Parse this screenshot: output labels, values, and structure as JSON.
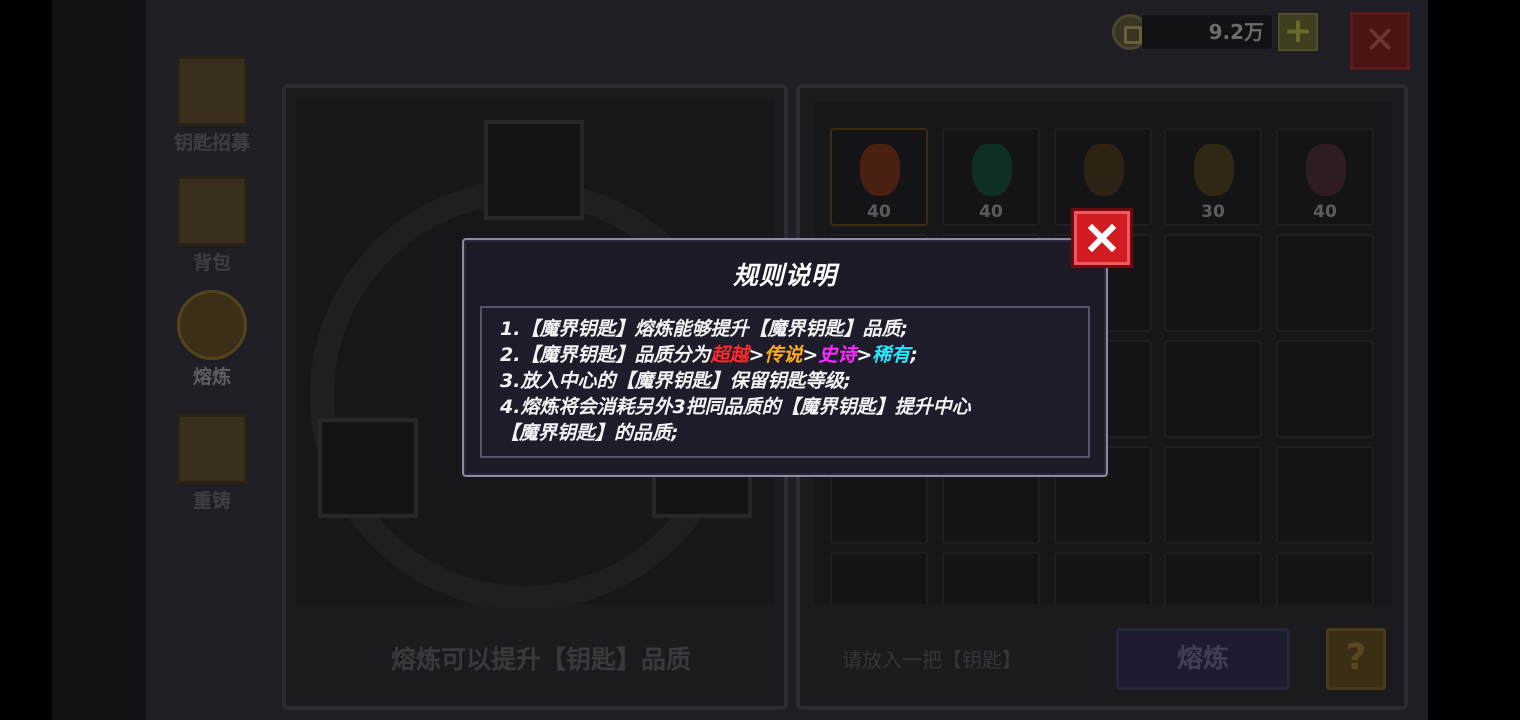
{
  "header": {
    "currency_amount": "9.2万",
    "add_label": "+",
    "close_label": "✕"
  },
  "sidebar": {
    "items": [
      {
        "label": "钥匙招募",
        "icon": "recruit-gate-icon"
      },
      {
        "label": "背包",
        "icon": "backpack-icon"
      },
      {
        "label": "熔炼",
        "icon": "smelt-icon",
        "active": true
      },
      {
        "label": "重铸",
        "icon": "recast-icon"
      }
    ]
  },
  "left_panel": {
    "hint": "熔炼可以提升【钥匙】品质"
  },
  "right_panel": {
    "keys": [
      {
        "level": "40",
        "color": "#4a2012"
      },
      {
        "level": "40",
        "color": "#0f2e26"
      },
      {
        "level": "",
        "color": "#2d2214"
      },
      {
        "level": "30",
        "color": "#2e2814"
      },
      {
        "level": "40",
        "color": "#2e1c24"
      }
    ],
    "hint": "请放入一把【钥匙】",
    "smelt_label": "熔炼",
    "help_label": "?"
  },
  "dialog": {
    "title": "规则说明",
    "rules": {
      "r1": "1.【魔界钥匙】熔炼能够提升【魔界钥匙】品质;",
      "r2_prefix": "2.【魔界钥匙】品质分为",
      "quality_super": "超越",
      "quality_legend": "传说",
      "quality_epic": "史诗",
      "quality_rare": "稀有",
      "sep": ">",
      "r2_end": ";",
      "r3": "3.放入中心的【魔界钥匙】保留钥匙等级;",
      "r4a": "4.熔炼将会消耗另外3把同品质的【魔界钥匙】提升中心",
      "r4b": "【魔界钥匙】的品质;"
    },
    "close_icon": "close-x-icon"
  },
  "colors": {
    "quality_super": "#ff2a2a",
    "quality_legend": "#ffae1a",
    "quality_epic": "#ff2aff",
    "quality_rare": "#2ae6ff",
    "close_button": "#d01c22"
  }
}
